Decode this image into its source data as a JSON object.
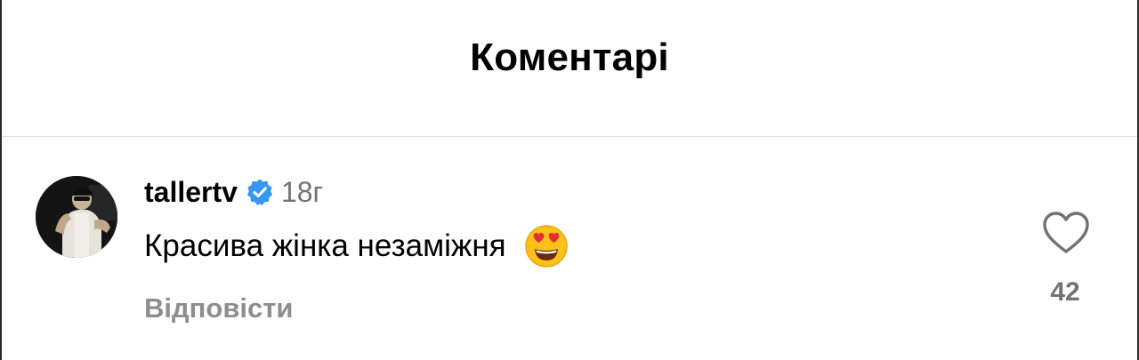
{
  "header": {
    "title": "Коментарі"
  },
  "comment": {
    "username": "tallertv",
    "verified": true,
    "time": "18г",
    "text": "Красива жінка незаміжня",
    "emoji": "smiling-face-with-heart-eyes",
    "reply_label": "Відповісти",
    "like_count": "42"
  },
  "colors": {
    "verified_badge": "#3897f0",
    "secondary_text": "#737373",
    "reply_text": "#8e8e8e",
    "divider": "#dbdbdb"
  }
}
